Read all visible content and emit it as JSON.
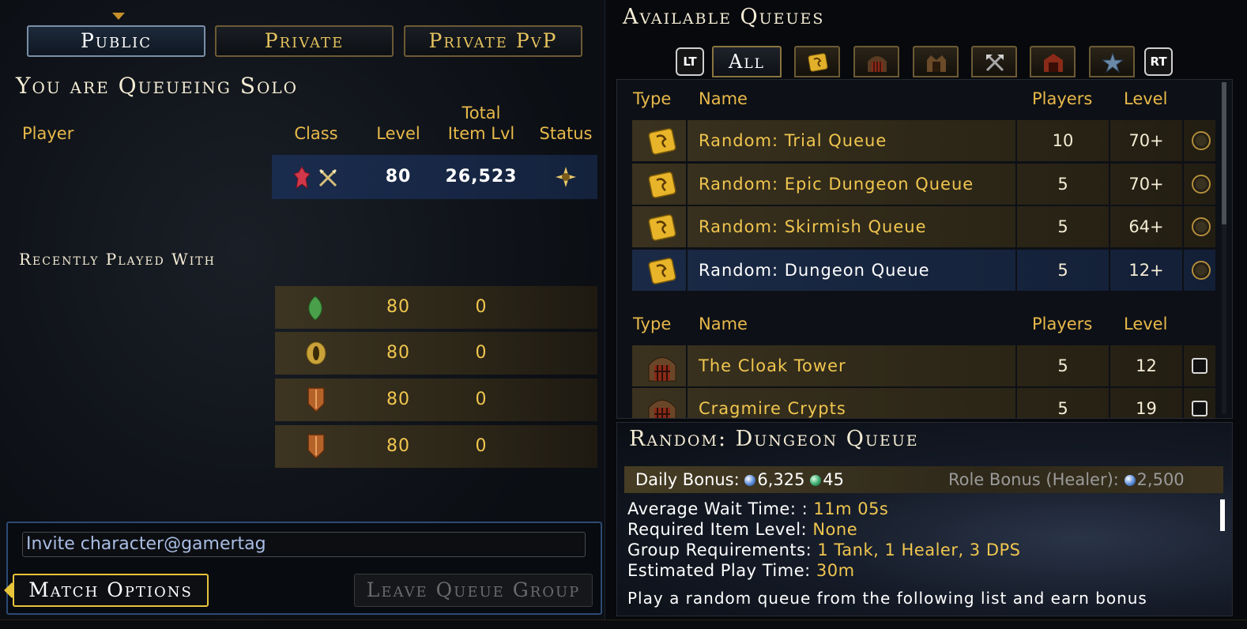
{
  "party_panel": {
    "tabs": [
      {
        "label": "Public",
        "active": true
      },
      {
        "label": "Private",
        "active": false
      },
      {
        "label": "Private PvP",
        "active": false
      }
    ],
    "title": "You are Queueing Solo",
    "columns": {
      "player": "Player",
      "class": "Class",
      "level": "Level",
      "total_item_lvl_1": "Total",
      "total_item_lvl_2": "Item Lvl",
      "status": "Status"
    },
    "player_row": {
      "level": "80",
      "item_level": "26,523",
      "class_icons": [
        "cleric-class-icon",
        "swords-role-icon"
      ],
      "status_icon": "ready-status-icon"
    },
    "recently_played_title": "Recently Played With",
    "recent": [
      {
        "class_icon": "green-leaf-class-icon",
        "level": "80",
        "item_level": "0"
      },
      {
        "class_icon": "gold-eye-class-icon",
        "level": "80",
        "item_level": "0"
      },
      {
        "class_icon": "shield-class-icon",
        "level": "80",
        "item_level": "0"
      },
      {
        "class_icon": "shield-class-icon",
        "level": "80",
        "item_level": "0"
      }
    ],
    "invite_placeholder": "Invite character@gamertag",
    "match_options": "Match Options",
    "leave_queue_group": "Leave Queue Group"
  },
  "queues_panel": {
    "title": "Available Queues",
    "lt": "LT",
    "rt": "RT",
    "tab_all": "All",
    "filter_tab_icons": [
      "random-dice-icon",
      "dungeon-gate-icon",
      "skirmish-gate-icon",
      "pvp-axes-icon",
      "trial-gate-icon",
      "star-icon"
    ],
    "random_header": {
      "type": "Type",
      "name": "Name",
      "players": "Players",
      "level": "Level"
    },
    "random_queues": [
      {
        "name": "Random: Trial Queue",
        "players": "10",
        "level": "70+",
        "selected": false
      },
      {
        "name": "Random: Epic Dungeon Queue",
        "players": "5",
        "level": "70+",
        "selected": false
      },
      {
        "name": "Random: Skirmish Queue",
        "players": "5",
        "level": "64+",
        "selected": false
      },
      {
        "name": "Random: Dungeon Queue",
        "players": "5",
        "level": "12+",
        "selected": true
      }
    ],
    "dungeon_header": {
      "type": "Type",
      "name": "Name",
      "players": "Players",
      "level": "Level"
    },
    "dungeon_queues": [
      {
        "name": "The Cloak Tower",
        "players": "5",
        "level": "12"
      },
      {
        "name": "Cragmire Crypts",
        "players": "5",
        "level": "19"
      }
    ]
  },
  "detail": {
    "title": "Random: Dungeon Queue",
    "daily_bonus_label": "Daily Bonus:",
    "daily_bonus_ad": "6,325",
    "daily_bonus_other": "45",
    "role_bonus_label": "Role Bonus (Healer):",
    "role_bonus_value": "2,500",
    "wait_label": "Average Wait Time: :",
    "wait_value": "11m 05s",
    "req_label": "Required Item Level:",
    "req_value": "None",
    "group_label": "Group Requirements:",
    "group_value": "1 Tank, 1 Healer, 3 DPS",
    "play_label": "Estimated Play Time:",
    "play_value": "30m",
    "description": "Play a random queue from the following list and earn bonus"
  }
}
